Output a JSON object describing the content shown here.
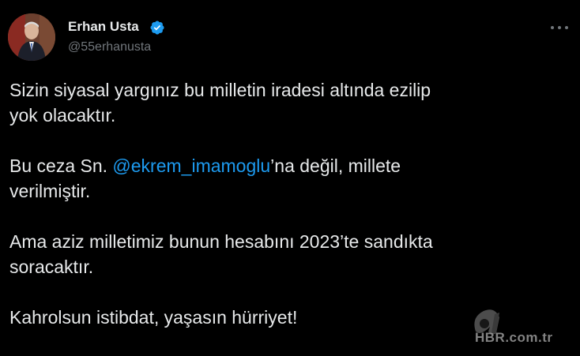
{
  "author": {
    "name": "Erhan Usta",
    "handle": "@55erhanusta",
    "verified": true
  },
  "tweet": {
    "paragraph_1": "Sizin siyasal yargınız bu milletin iradesi altında ezilip",
    "paragraph_1b": "yok olacaktır.",
    "paragraph_2_prefix": "Bu ceza Sn. ",
    "paragraph_2_mention": "@ekrem_imamoglu",
    "paragraph_2_suffix": "’na değil, millete",
    "paragraph_2b": "verilmiştir.",
    "paragraph_3": "Ama aziz milletimiz bunun hesabını 2023’te sandıkta",
    "paragraph_3b": "soracaktır.",
    "paragraph_4": "Kahrolsun istibdat, yaşasın hürriyet!"
  },
  "watermark": {
    "text": "HBR.com.tr"
  },
  "colors": {
    "background": "#000000",
    "text": "#e7e9ea",
    "secondary": "#71767b",
    "link": "#1d9bf0",
    "verified": "#1d9bf0"
  },
  "icons": {
    "verified": "verified-badge-icon",
    "more": "more-options-icon"
  }
}
